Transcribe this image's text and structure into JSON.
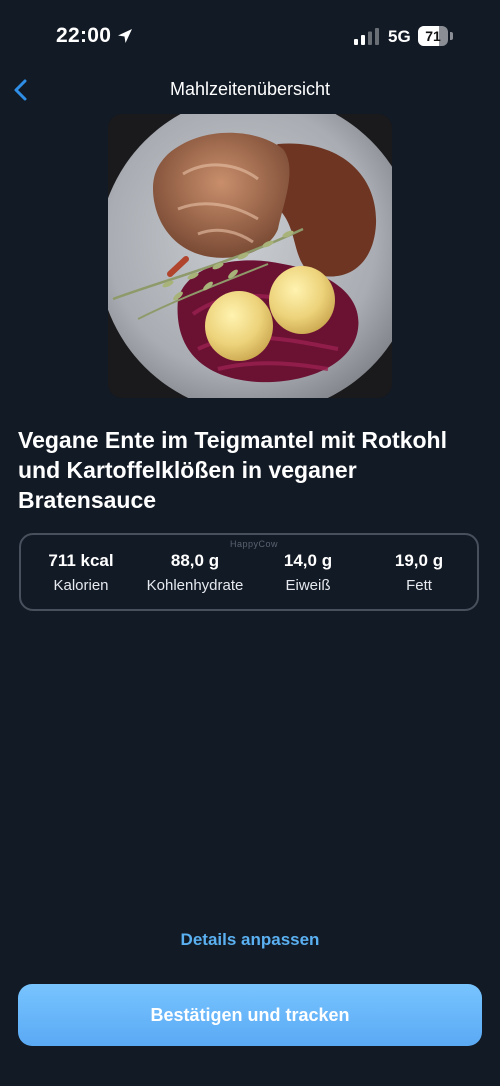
{
  "status_bar": {
    "time": "22:00",
    "network": "5G",
    "battery_percent": 71,
    "battery_label": "71"
  },
  "nav": {
    "title": "Mahlzeitenübersicht",
    "back_icon": "chevron-left-icon",
    "accent_color": "#2f8fe6"
  },
  "meal": {
    "title": "Vegane Ente im Teigmantel mit Rotkohl und Kartoffelklößen in veganer Bratensauce"
  },
  "nutrition": {
    "watermark": "HappyCow",
    "items": [
      {
        "value": "711 kcal",
        "label": "Kalorien"
      },
      {
        "value": "88,0 g",
        "label": "Kohlenhydrate"
      },
      {
        "value": "14,0 g",
        "label": "Eiweiß"
      },
      {
        "value": "19,0 g",
        "label": "Fett"
      }
    ]
  },
  "actions": {
    "details_label": "Details anpassen",
    "confirm_label": "Bestätigen und tracken"
  },
  "colors": {
    "background": "#121a26",
    "link": "#5ab0f0",
    "button": "#6bb8fb"
  }
}
